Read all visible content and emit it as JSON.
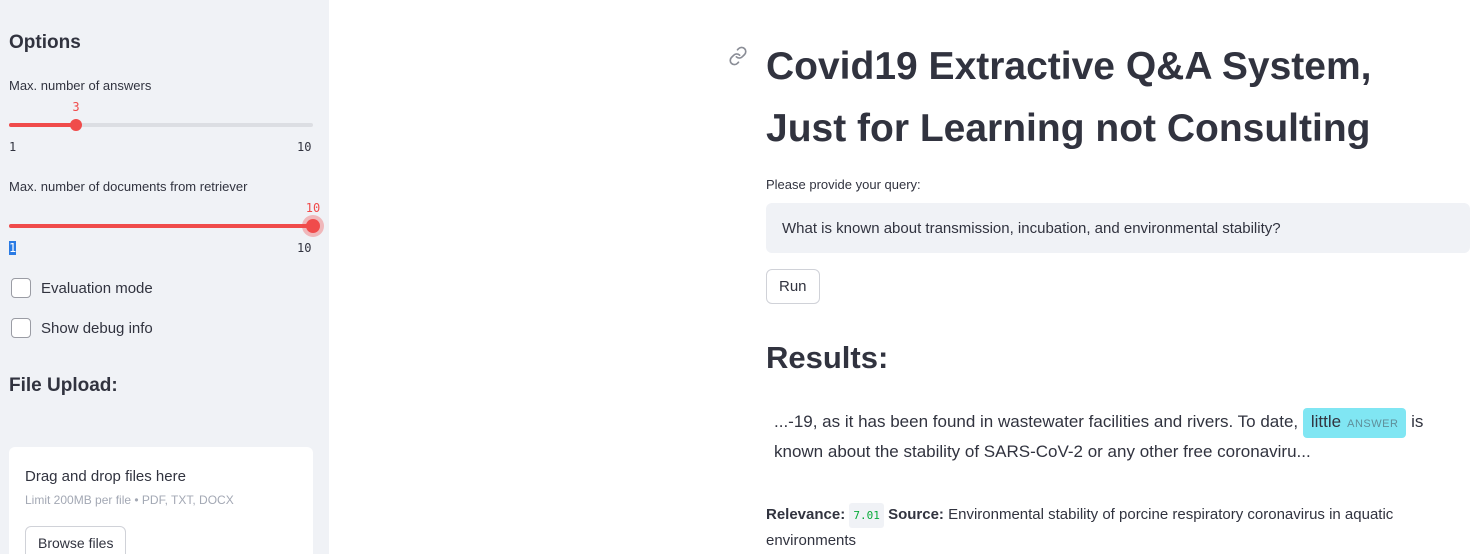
{
  "sidebar": {
    "options_heading": "Options",
    "answers_slider": {
      "label": "Max. number of answers",
      "value": "3",
      "min": "1",
      "max": "10",
      "fraction": 0.222
    },
    "docs_slider": {
      "label": "Max. number of documents from retriever",
      "value": "10",
      "min": "1",
      "max": "10",
      "fraction": 1.0
    },
    "eval_mode": {
      "label": "Evaluation mode",
      "checked": false
    },
    "debug_info": {
      "label": "Show debug info",
      "checked": false
    },
    "file_upload_heading": "File Upload:",
    "uploader": {
      "title": "Drag and drop files here",
      "limit": "Limit 200MB per file • PDF, TXT, DOCX",
      "browse_label": "Browse files"
    }
  },
  "main": {
    "title_line1": "Covid19 Extractive Q&A System,",
    "title_line2": "Just for Learning not Consulting",
    "query_label": "Please provide your query:",
    "query_value": "What is known about transmission, incubation, and environmental stability?",
    "run_label": "Run",
    "results_heading": "Results:",
    "answer": {
      "before": "...-19, as it has been found in wastewater facilities and rivers. To date,",
      "highlight": "little",
      "tag": "ANSWER",
      "after": "is known about the stability of SARS-CoV-2 or any other free coronaviru..."
    },
    "relevance_label": "Relevance:",
    "relevance_value": "7.01",
    "source_label": "Source:",
    "source_value": "Environmental stability of porcine respiratory coronavirus in aquatic environments"
  },
  "colors": {
    "accent": "#f04b4b",
    "sidebar_bg": "#f0f2f6",
    "answer_highlight": "#80e6f3",
    "relevance_green": "#09ab3b"
  },
  "icons": {
    "heading_anchor": "link-icon"
  }
}
